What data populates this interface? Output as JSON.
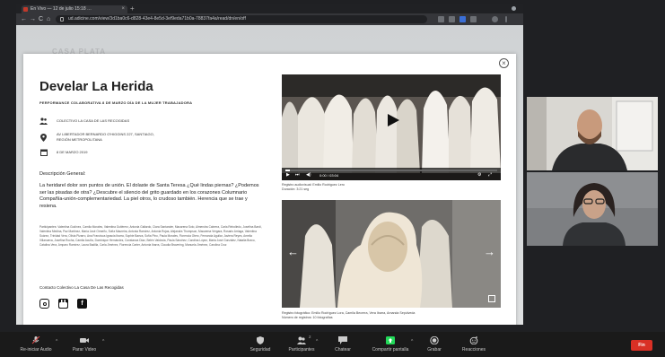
{
  "browser": {
    "tab_title": "En Vivo — 12 de julio 15:18 …",
    "tab_close": "×",
    "tab_new": "+",
    "url": "ud.adicine.com/view/3d1ba0c6-d828-43e4-8e5d-3ef9eda71b0a-78837fa4a/read/dn/en/off",
    "nav_back": "←",
    "nav_forward": "→",
    "nav_reload": "C",
    "nav_home": "⌂"
  },
  "background_text": "CASA PLATA",
  "modal": {
    "close_label": "×",
    "title": "Develar La Herida",
    "subtitle": "PERFORMANCE COLABORATIVA 8 DE MARZO DÍA DE LA MUJER TRABAJADORA",
    "info": [
      {
        "icon": "group-icon",
        "text": "COLECTIVO LA CASA DE LAS RECOGIDAS"
      },
      {
        "icon": "location-pin-icon",
        "text": "AV LIBERTADOR BERNARDO O'HIGGINS 227, SANTIAGO,\nREGIÓN METROPOLITANA"
      },
      {
        "icon": "calendar-icon",
        "text": "8 DE MARZO 2019"
      }
    ],
    "description_title": "Descripción General:",
    "description": "La heridarel dolor son puntos de unión. El dolaste de Santa Teresa ¿Qué lindas piernas? ¿Podemos ser las pisadas de otra? ¿Descubre el silencio del grito guardado en los corazones Columnario Compañía-unión-complementariedad. La piel otros, lo crudoso también. Herencia que se trae y resiena.",
    "participants": "Participantes: Valentina Godínez, Camila Morales, Valentina Gutiérrez, Antonia Gallardo, Clara Santander, Macarena Soto, Almendra Cabrera, Carla Rebolledo, Josefina Bardi, Valentina Medina, Paz Martínez, María José Ormeño, Sofía Maureira, Antonia Ramírez, Antonia Rojas, Alejandra Thompson, Macarena Vergara, Rosario Arriaga, Valentina Suárez, Trinidad Vera, Olivia Pizarro, Ana Francisca Ignacia Ibarra, Sophie Baeza, Sofía Pino, Paula Morales, Florencia Otero, Fernanda Aguilar, Javiera Reyes, Amelia Villanueva, Josefina Rocha, Camila Acuña, Dominique Hernández, Constanza Díaz, Belén Valdovia, Paula Sánchez, Carolina López, Maria José González, Natalia Bravo, Catalina Vera, Amparo Ramírez, Laura Badilla, Carla Jiménez, Florencia Carter, Antonia Ibarra, Claudia Bravering, Manuela Jiménez, Carolina Cruz",
    "contact": "Contacto Colectivo La Casa De Las Recogidas",
    "video": {
      "time": "0:00 / 03:04",
      "progress": 0.02,
      "caption": "Registro audiovisual: Emilio Rodríguez Lero\nDuración: 3:21 seg"
    },
    "gallery_caption": "Registro fotográfico: Emilio Rodríguez Lora, Camila Becerra, Vera Ibarra, Amanda Sepúlveda\nNúmero de registros: 10 fotografías"
  },
  "zoom_bar": {
    "items": [
      {
        "label": "Re-iniciar Audio",
        "icon": "microphone-muted-icon"
      },
      {
        "label": "Parar Video",
        "icon": "video-camera-icon"
      },
      {
        "label": "Seguridad",
        "icon": "shield-icon"
      },
      {
        "label": "Participantes",
        "icon": "participants-icon",
        "badge": "2"
      },
      {
        "label": "Chatear",
        "icon": "chat-icon"
      },
      {
        "label": "Compartir pantalla",
        "icon": "share-screen-icon"
      },
      {
        "label": "Grabar",
        "icon": "record-icon"
      },
      {
        "label": "Reacciones",
        "icon": "reactions-icon"
      }
    ],
    "end_label": "Fin",
    "caret": "^"
  },
  "colors": {
    "zoom_bg": "#1a1a1a",
    "share_icon_green": "#23d959",
    "end_red": "#d93025"
  }
}
